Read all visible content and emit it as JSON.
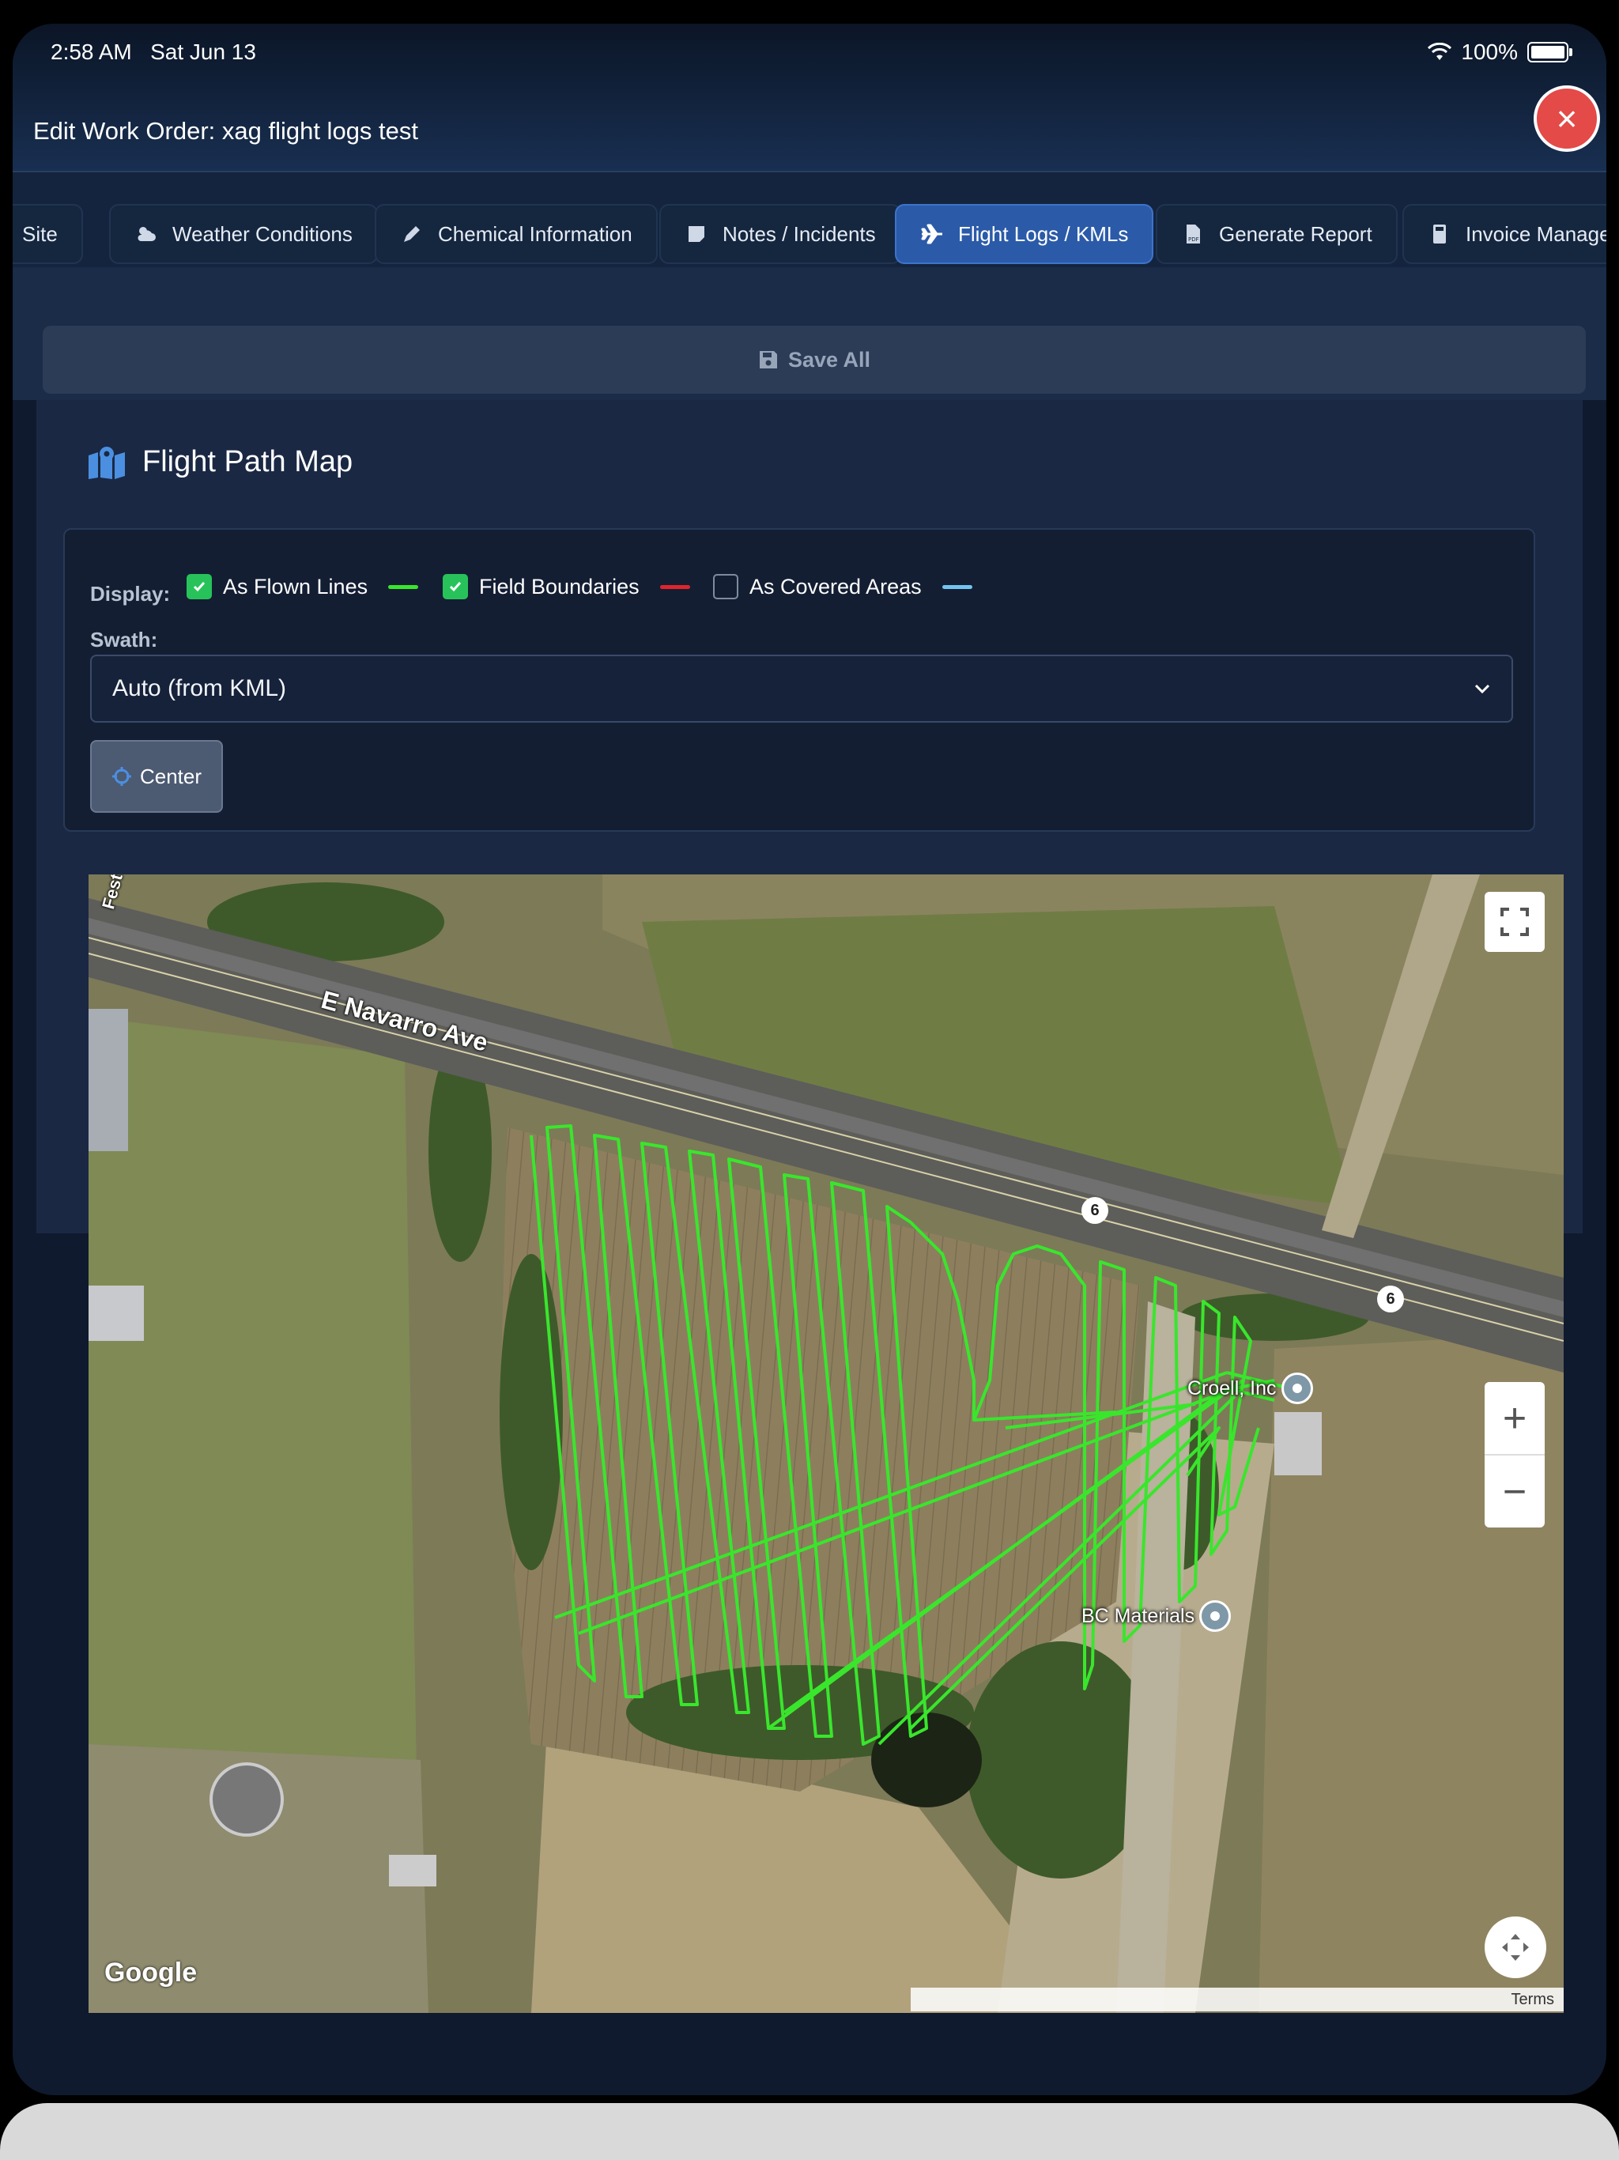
{
  "status": {
    "time": "2:58 AM",
    "date": "Sat Jun 13",
    "battery": "100%"
  },
  "header": {
    "title": "Edit Work Order: xag flight logs test",
    "close_label": "×"
  },
  "tabs": [
    {
      "label": "Site",
      "icon": "none"
    },
    {
      "label": "Weather Conditions",
      "icon": "cloud-sun-icon"
    },
    {
      "label": "Chemical Information",
      "icon": "pen-icon"
    },
    {
      "label": "Notes / Incidents",
      "icon": "note-icon"
    },
    {
      "label": "Flight Logs / KMLs",
      "icon": "plane-icon",
      "active": true
    },
    {
      "label": "Generate Report",
      "icon": "pdf-icon"
    },
    {
      "label": "Invoice Managem",
      "icon": "calculator-icon"
    }
  ],
  "toolbar": {
    "save_label": "Save All"
  },
  "section": {
    "title": "Flight Path Map"
  },
  "display": {
    "label": "Display:",
    "options": [
      {
        "label": "As Flown Lines",
        "checked": true,
        "color": "#39e62c"
      },
      {
        "label": "Field Boundaries",
        "checked": true,
        "color": "#e0242c"
      },
      {
        "label": "As Covered Areas",
        "checked": false,
        "color": "#73c3f0"
      }
    ]
  },
  "swath": {
    "label": "Swath:",
    "value": "Auto (from KML)"
  },
  "center_label": "Center",
  "map": {
    "road_label": "E Navarro Ave",
    "edge_label": "Fest",
    "route_shield": "6",
    "pois": [
      "Croell, Inc",
      "BC Materials"
    ],
    "zoom_in": "+",
    "zoom_out": "−",
    "attribution": "Google",
    "terms": "Terms",
    "flight_line_color": "#39e62c"
  }
}
